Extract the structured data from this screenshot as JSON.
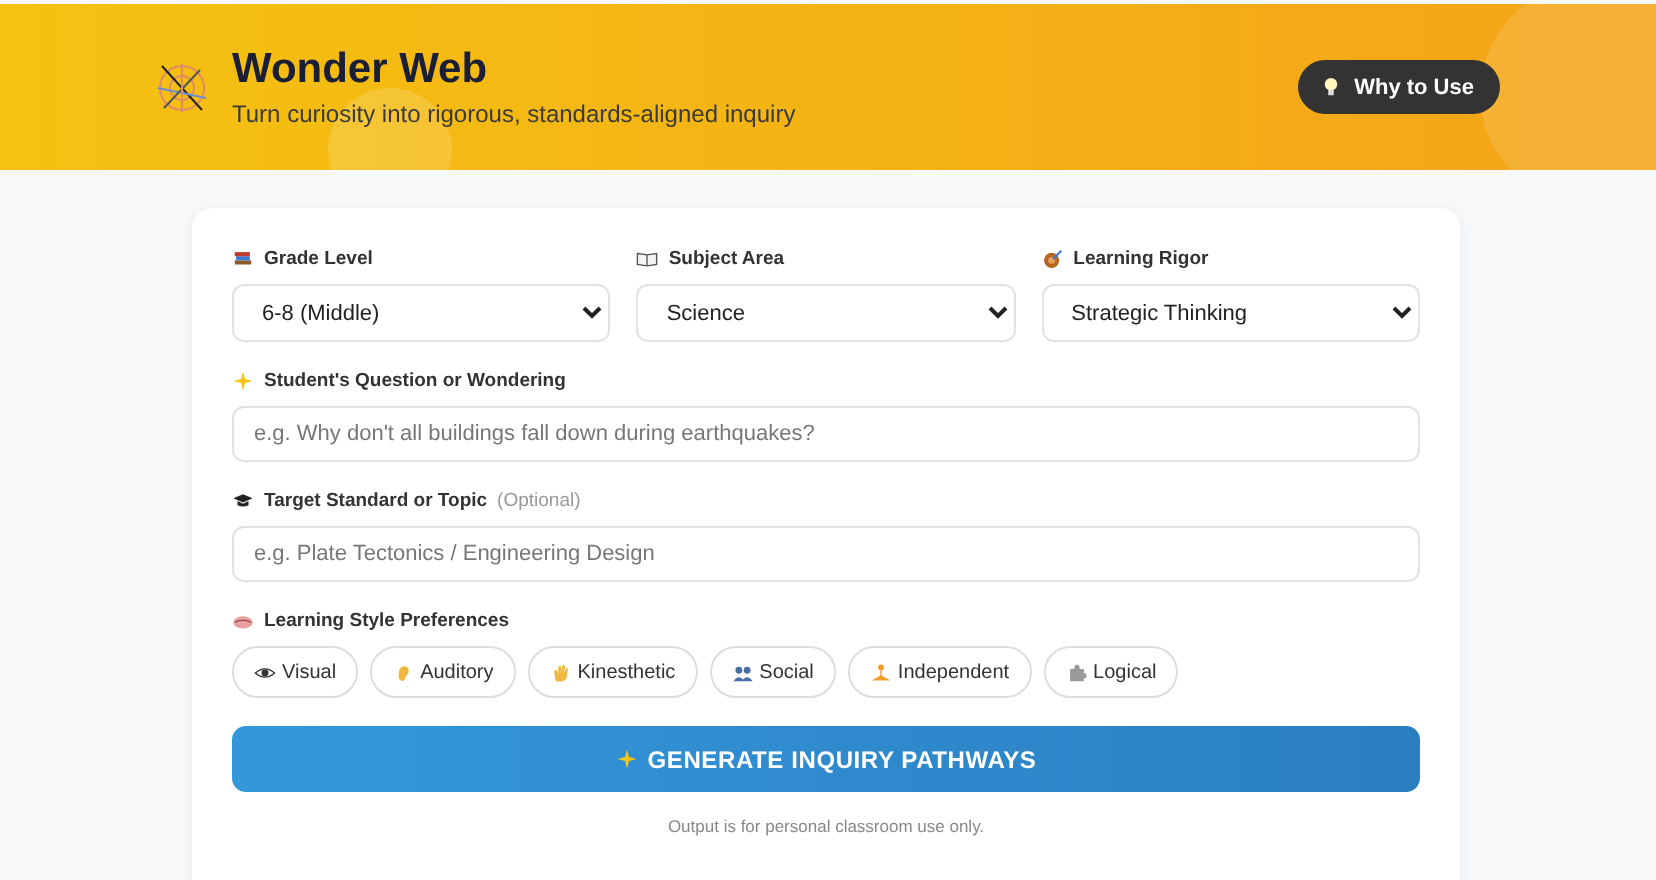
{
  "header": {
    "title": "Wonder Web",
    "subtitle": "Turn curiosity into rigorous, standards-aligned inquiry",
    "button": "Why to Use"
  },
  "selects": [
    {
      "label": "Grade Level",
      "value": "6-8 (Middle)",
      "kind": "grade"
    },
    {
      "label": "Subject Area",
      "value": "Science",
      "kind": "subject"
    },
    {
      "label": "Learning Rigor",
      "value": "Strategic Thinking",
      "kind": "rigor"
    }
  ],
  "question": {
    "label": "Student's Question or Wondering",
    "placeholder": "e.g. Why don't all buildings fall down during earthquakes?"
  },
  "standard": {
    "label": "Target Standard or Topic",
    "note": "(Optional)",
    "placeholder": "e.g. Plate Tectonics / Engineering Design"
  },
  "styles": {
    "label": "Learning Style Preferences",
    "options": [
      {
        "label": "Visual",
        "kind": "visual",
        "selected": false
      },
      {
        "label": "Auditory",
        "kind": "auditory",
        "selected": false
      },
      {
        "label": "Kinesthetic",
        "kind": "kinesthetic",
        "selected": false
      },
      {
        "label": "Social",
        "kind": "social",
        "selected": false
      },
      {
        "label": "Independent",
        "kind": "independent",
        "selected": false
      },
      {
        "label": "Logical",
        "kind": "logical",
        "selected": false
      }
    ]
  },
  "generate_button": "GENERATE INQUIRY PATHWAYS",
  "footnote": "Output is for personal classroom use only."
}
